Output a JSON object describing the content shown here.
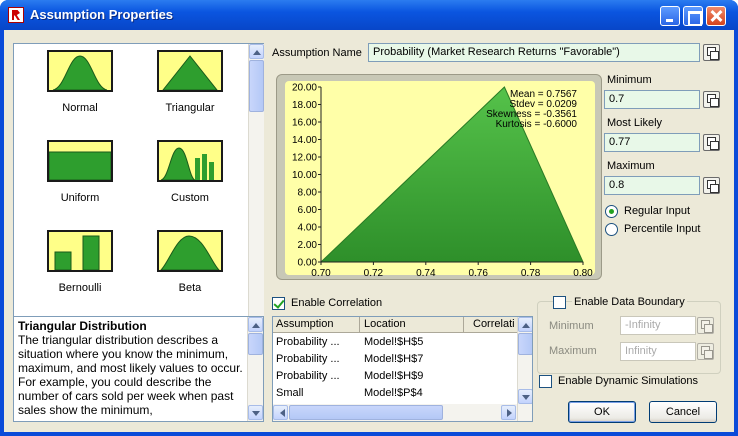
{
  "window": {
    "title": "Assumption Properties"
  },
  "gallery": {
    "items": [
      {
        "label": "Normal",
        "icon": "normal-distribution-icon"
      },
      {
        "label": "Triangular",
        "icon": "triangular-distribution-icon",
        "selected": true
      },
      {
        "label": "Uniform",
        "icon": "uniform-distribution-icon"
      },
      {
        "label": "Custom",
        "icon": "custom-distribution-icon"
      },
      {
        "label": "Bernoulli",
        "icon": "bernoulli-distribution-icon"
      },
      {
        "label": "Beta",
        "icon": "beta-distribution-icon"
      }
    ]
  },
  "description": {
    "title": "Triangular Distribution",
    "text": "The triangular distribution describes a situation where you know the minimum, maximum, and most likely values to occur. For example, you could describe the number of cars sold per week when past sales show the minimum,"
  },
  "assumption": {
    "name_label": "Assumption Name",
    "name_value": "Probability (Market Research Returns \"Favorable\")"
  },
  "parameters": {
    "minimum_label": "Minimum",
    "minimum_value": "0.7",
    "most_likely_label": "Most Likely",
    "most_likely_value": "0.77",
    "maximum_label": "Maximum",
    "maximum_value": "0.8",
    "regular_input_label": "Regular Input",
    "percentile_input_label": "Percentile Input",
    "input_mode": "regular"
  },
  "stats": {
    "mean": "Mean = 0.7567",
    "stdev": "Stdev = 0.0209",
    "skewness": "Skewness = -0.3561",
    "kurtosis": "Kurtosis = -0.6000"
  },
  "chart_data": {
    "type": "area",
    "x": [
      0.7,
      0.77,
      0.8
    ],
    "y": [
      0,
      20,
      0
    ],
    "xlim": [
      0.7,
      0.8
    ],
    "ylim": [
      0,
      20
    ],
    "x_ticks": [
      "0.70",
      "0.72",
      "0.74",
      "0.76",
      "0.78",
      "0.80"
    ],
    "y_ticks": [
      "0.00",
      "2.00",
      "4.00",
      "6.00",
      "8.00",
      "10.00",
      "12.00",
      "14.00",
      "16.00",
      "18.00",
      "20.00"
    ],
    "fill_color": "#3fae35",
    "background": "#ffffa8"
  },
  "correlation": {
    "enable_label": "Enable Correlation",
    "enabled": true,
    "columns": [
      "Assumption",
      "Location",
      "Correlati"
    ],
    "rows": [
      [
        "Probability ...",
        "Model!$H$5"
      ],
      [
        "Probability ...",
        "Model!$H$7"
      ],
      [
        "Probability ...",
        "Model!$H$9"
      ],
      [
        "Small",
        "Model!$P$4"
      ]
    ]
  },
  "boundary": {
    "enable_label": "Enable Data Boundary",
    "enabled": false,
    "minimum_label": "Minimum",
    "minimum_placeholder": "-Infinity",
    "maximum_label": "Maximum",
    "maximum_placeholder": "Infinity"
  },
  "dynamic": {
    "label": "Enable Dynamic Simulations",
    "enabled": false
  },
  "buttons": {
    "ok": "OK",
    "cancel": "Cancel"
  },
  "colors": {
    "accent_green_field": "#e8f8e8",
    "titlebar": "#0a55e0"
  }
}
